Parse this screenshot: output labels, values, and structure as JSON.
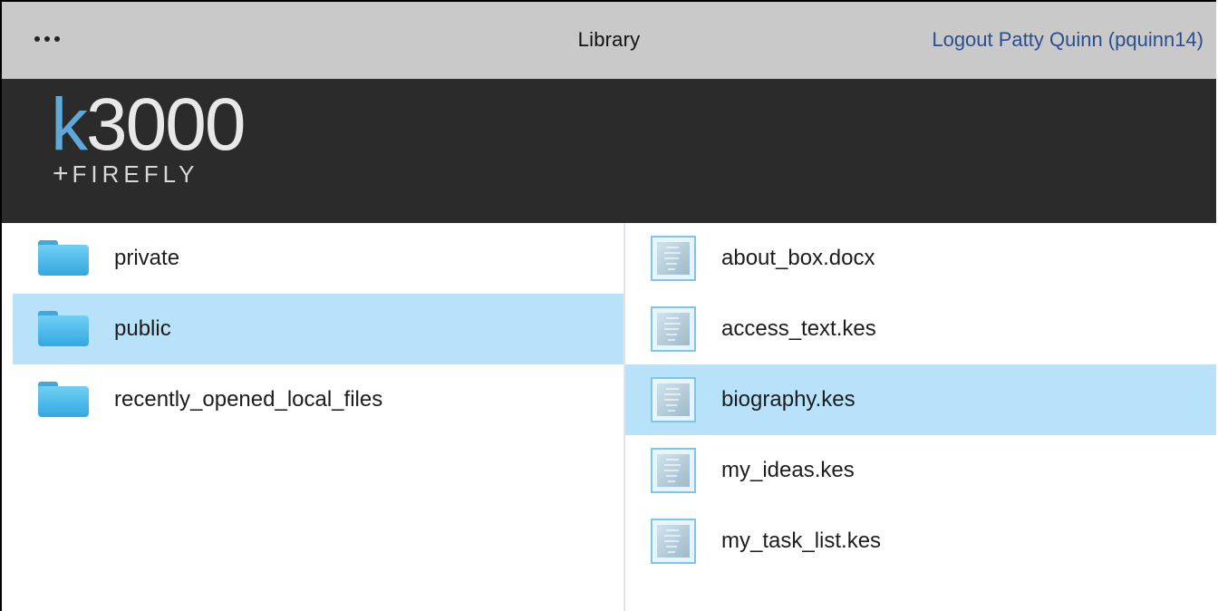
{
  "topbar": {
    "menu_icon": "more-dots-icon",
    "title": "Library",
    "logout": "Logout Patty Quinn (pquinn14)"
  },
  "brand": {
    "logo_k": "k",
    "logo_number": "3000",
    "logo_plus": "+",
    "logo_sub": "FIREFLY",
    "colors": {
      "accent": "#5fa8d8",
      "header_bg": "#2b2b2b"
    }
  },
  "folders": [
    {
      "label": "private",
      "selected": false,
      "icon": "folder-icon"
    },
    {
      "label": "public",
      "selected": true,
      "icon": "folder-icon"
    },
    {
      "label": "recently_opened_local_files",
      "selected": false,
      "icon": "folder-icon"
    }
  ],
  "files": [
    {
      "label": "about_box.docx",
      "selected": false,
      "icon": "file-icon"
    },
    {
      "label": "access_text.kes",
      "selected": false,
      "icon": "file-icon"
    },
    {
      "label": "biography.kes",
      "selected": true,
      "icon": "file-icon"
    },
    {
      "label": "my_ideas.kes",
      "selected": false,
      "icon": "file-icon"
    },
    {
      "label": "my_task_list.kes",
      "selected": false,
      "icon": "file-icon"
    }
  ],
  "colors": {
    "selection": "#b7e2f9",
    "topbar_bg": "#c9c9c9",
    "link": "#2b4f8e"
  }
}
